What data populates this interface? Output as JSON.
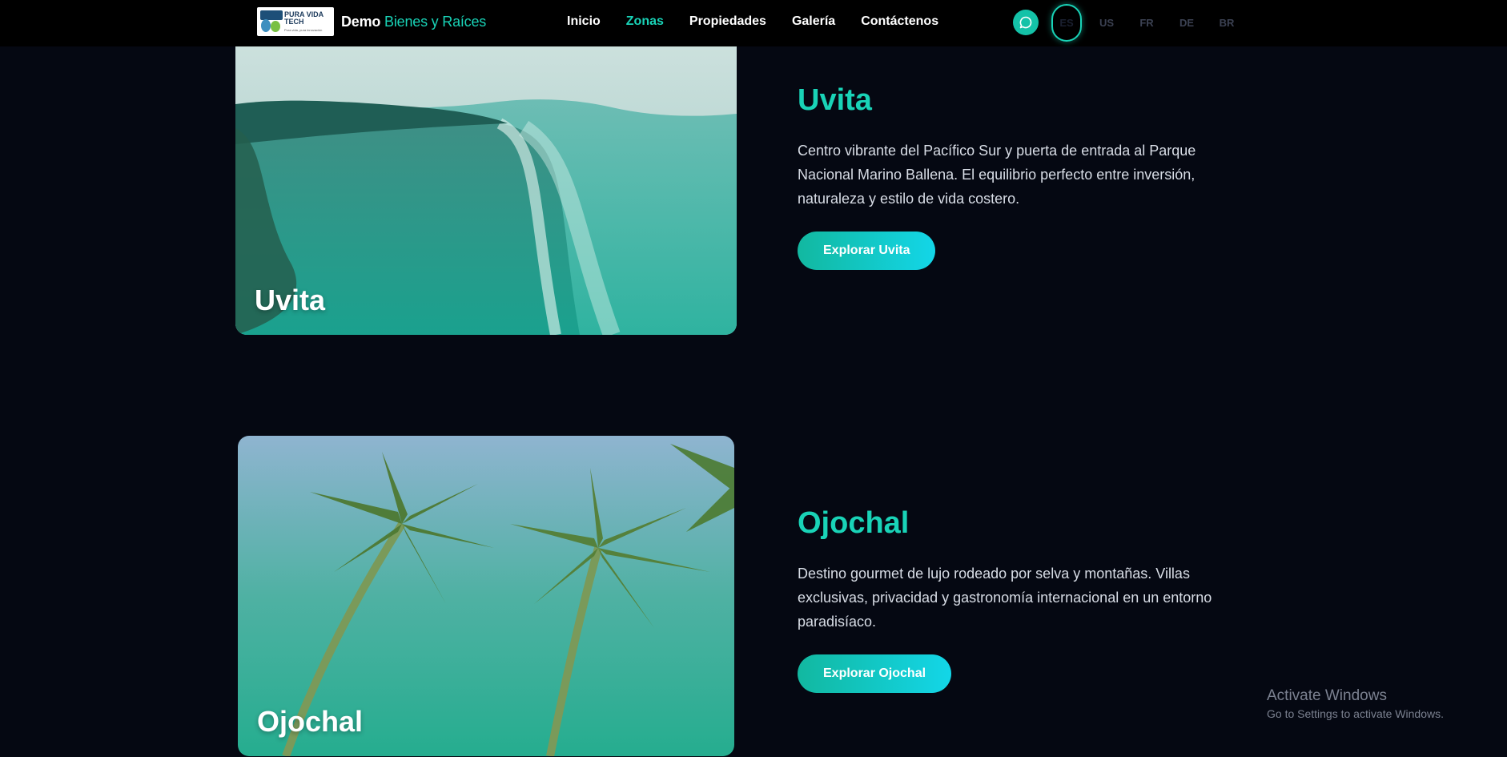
{
  "header": {
    "logo": {
      "line1": "PURA VIDA",
      "line2": "TECH",
      "tagline": "Pura vida, pura innovación"
    },
    "brand_name": "Demo",
    "brand_accent": "Bienes y Raíces",
    "nav": [
      {
        "label": "Inicio",
        "active": false
      },
      {
        "label": "Zonas",
        "active": true
      },
      {
        "label": "Propiedades",
        "active": false
      },
      {
        "label": "Galería",
        "active": false
      },
      {
        "label": "Contáctenos",
        "active": false
      }
    ],
    "chat_icon": "chat-bubble-icon",
    "languages": [
      "ES",
      "US",
      "FR",
      "DE",
      "BR"
    ],
    "active_language": "ES"
  },
  "zones": [
    {
      "name": "Uvita",
      "image_label": "Uvita",
      "description": "Centro vibrante del Pacífico Sur y puerta de entrada al Parque Nacional Marino Ballena. El equilibrio perfecto entre inversión, naturaleza y estilo de vida costero.",
      "button": "Explorar Uvita"
    },
    {
      "name": "Ojochal",
      "image_label": "Ojochal",
      "description": "Destino gourmet de lujo rodeado por selva y montañas. Villas exclusivas, privacidad y gastronomía internacional en un entorno paradisíaco.",
      "button": "Explorar Ojochal"
    }
  ],
  "watermark": {
    "title": "Activate Windows",
    "subtitle": "Go to Settings to activate Windows."
  },
  "colors": {
    "accent": "#19d3b7",
    "background": "#050812",
    "header": "#000000"
  }
}
